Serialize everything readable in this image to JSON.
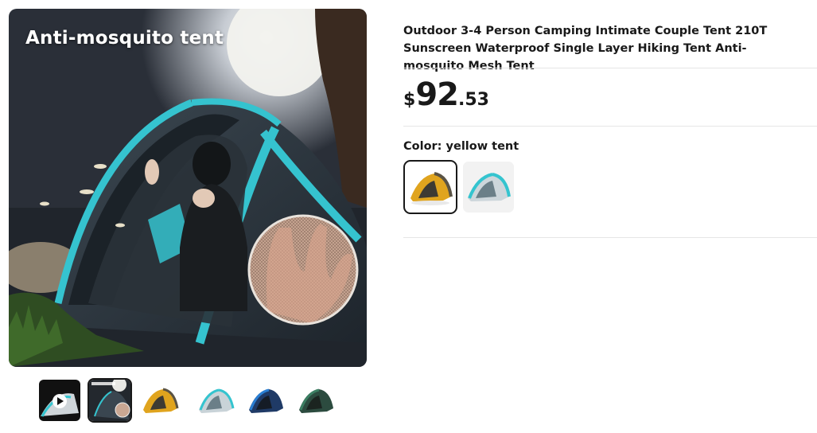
{
  "gallery": {
    "main_image": {
      "subject": "tent-at-night-with-mesh-closeup",
      "overlay_caption": "Anti-mosquito tent"
    },
    "thumbnails": [
      {
        "subject": "video-thumbnail",
        "icon": "play-icon",
        "active": false
      },
      {
        "subject": "anti-mosquito-tent",
        "active": true
      },
      {
        "subject": "yellow-tent",
        "active": false
      },
      {
        "subject": "light-blue-tent",
        "active": false
      },
      {
        "subject": "navy-blue-tent",
        "active": false
      },
      {
        "subject": "dark-green-tent",
        "active": false
      }
    ]
  },
  "product": {
    "title": "Outdoor 3-4 Person Camping Intimate Couple Tent 210T Sunscreen Waterproof Single Layer Hiking Tent Anti-mosquito Mesh Tent",
    "price": {
      "currency": "$",
      "integer": "92",
      "decimal": ".53"
    },
    "color": {
      "label": "Color: yellow tent",
      "options": [
        {
          "name": "yellow tent",
          "swatch": "yellow-tent",
          "selected": true
        },
        {
          "name": "light blue tent",
          "swatch": "light-blue-tent",
          "selected": false
        }
      ]
    }
  },
  "colors": {
    "text": "#191919",
    "divider": "#e6e6e6",
    "selected_outline": "#191919",
    "tent_yellow": "#e0a41e",
    "tent_cyan": "#34c4cf"
  }
}
